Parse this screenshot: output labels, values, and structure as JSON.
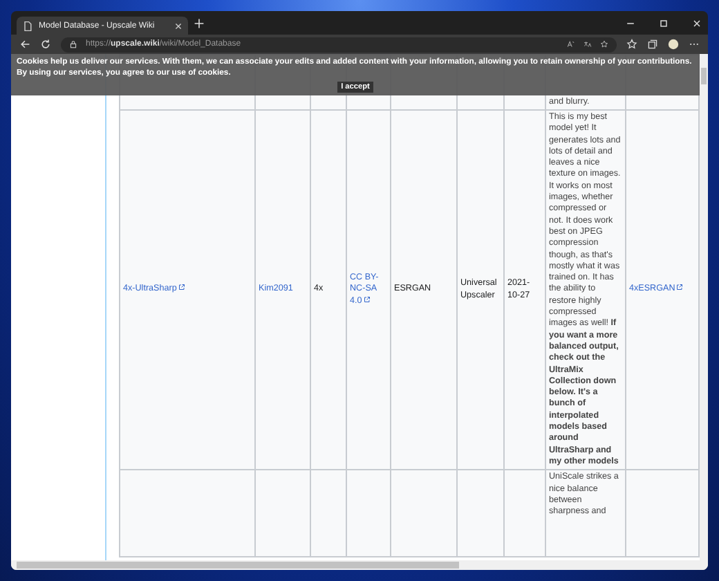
{
  "browser": {
    "tab": {
      "title": "Model Database - Upscale Wiki",
      "selected": true
    },
    "address": "https://**upscale.wiki**/wiki/Model_Database"
  },
  "cookie_banner": {
    "message": "Cookies help us deliver our services. With them, we can associate your edits and added content with your information, allowing you to retain ownership of your contributions. By using our services, you agree to our use of cookies.",
    "button": "I accept"
  },
  "table": {
    "rows": [
      {
        "description": "and blurry."
      },
      {
        "name": "4x-UltraSharp",
        "author": "Kim2091",
        "scale": "4x",
        "license": "CC BY-NC-SA 4.0",
        "architecture": "ESRGAN",
        "purpose": "Universal Upscaler",
        "date": "2021-10-27",
        "description": "This is my best model yet! It generates lots and lots of detail and leaves a nice texture on images. It works on most images, whether compressed or not. It does work best on JPEG compression though, as that's mostly what it was trained on. It has the ability to restore highly compressed images as well! **If you want a more balanced output, check out the UltraMix Collection down below. It's a bunch of interpolated models based around UltraSharp and my other models**",
        "link": "4xESRGAN"
      },
      {
        "description": "UniScale strikes a nice balance between sharpness and"
      }
    ]
  }
}
